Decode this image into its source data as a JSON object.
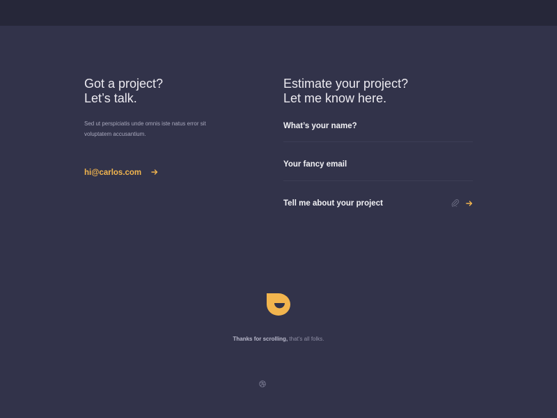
{
  "contact": {
    "headline_line1": "Got a project?",
    "headline_line2": "Let’s talk.",
    "intro": "Sed ut perspiciatis unde omnis iste natus error sit voluptatem accusantium.",
    "email": "hi@carlos.com"
  },
  "estimate": {
    "headline_line1": "Estimate your project?",
    "headline_line2": "Let me know here.",
    "name_placeholder": "What’s your name?",
    "email_placeholder": "Your fancy email",
    "project_placeholder": "Tell me about your project"
  },
  "footer": {
    "thanks_bold": "Thanks for scrolling,",
    "thanks_rest": " that’s all folks."
  },
  "icons": {
    "arrow": "arrow-right-icon",
    "attach": "paperclip-icon",
    "logo": "logo-icon",
    "social": "dribbble-icon"
  },
  "colors": {
    "background": "#32334a",
    "topbar": "#262739",
    "accent": "#f2b54e",
    "text": "#f2f2f5",
    "muted": "#a9a9bd"
  }
}
